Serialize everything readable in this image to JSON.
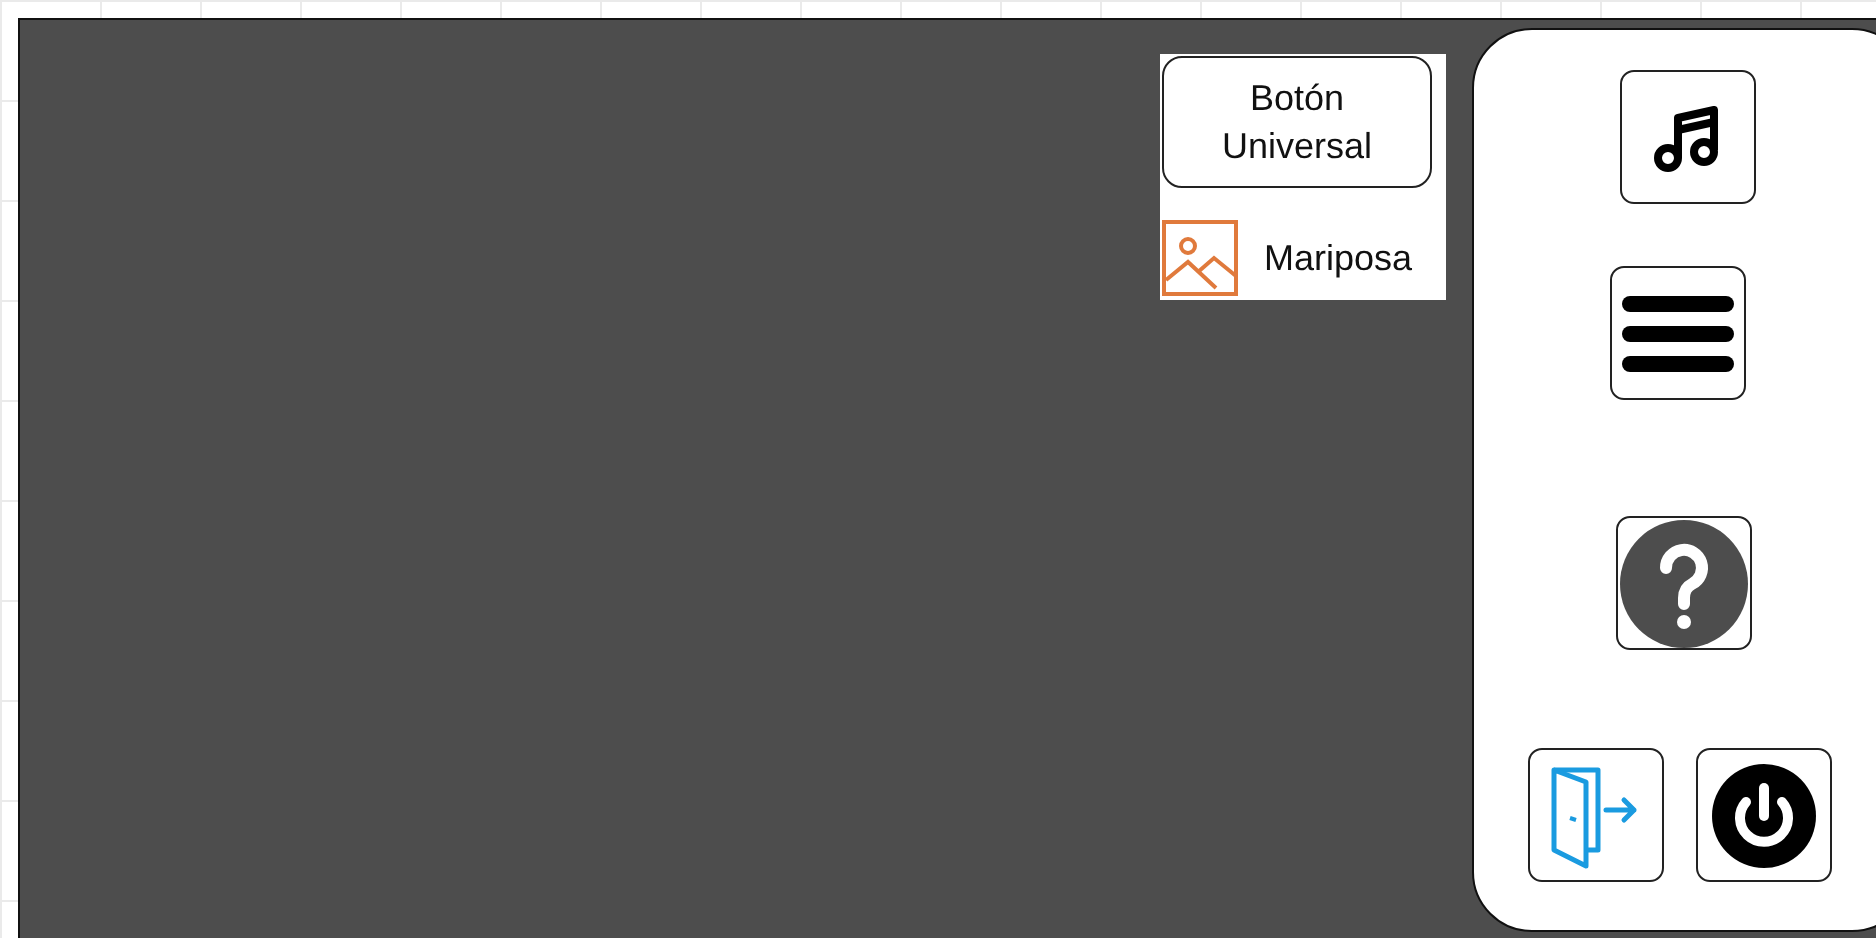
{
  "palette": {
    "button": "Botón Universal",
    "image_label": "Mariposa"
  },
  "sidebar": {
    "buttons": [
      {
        "kind": "music"
      },
      {
        "kind": "menu"
      },
      {
        "kind": "help"
      },
      {
        "kind": "exit"
      },
      {
        "kind": "power"
      }
    ]
  }
}
